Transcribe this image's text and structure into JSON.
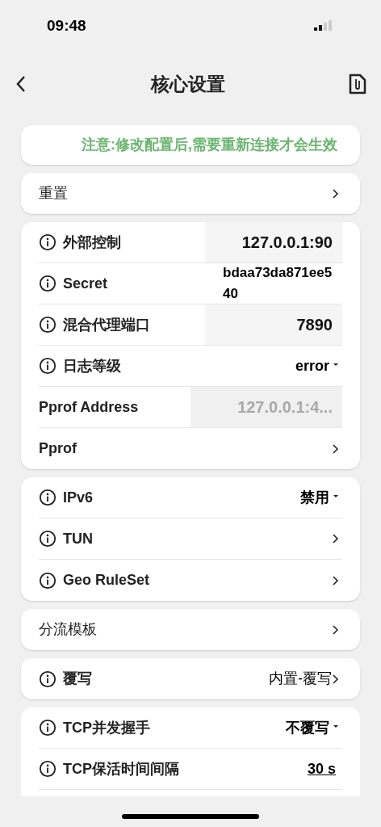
{
  "status_bar": {
    "time": "09:48"
  },
  "header": {
    "title": "核心设置"
  },
  "notice": "注意:修改配置后,需要重新连接才会生效",
  "cards": [
    {
      "rows": [
        {
          "kind": "link",
          "info": false,
          "label": "重置"
        }
      ]
    },
    {
      "rows": [
        {
          "kind": "input",
          "info": true,
          "label": "外部控制",
          "value": "127.0.0.1:90",
          "disabled": false
        },
        {
          "kind": "text",
          "info": true,
          "label": "Secret",
          "value": "bdaa73da871ee540"
        },
        {
          "kind": "input",
          "info": true,
          "label": "混合代理端口",
          "value": "7890",
          "disabled": false
        },
        {
          "kind": "dropdown",
          "info": true,
          "label": "日志等级",
          "value": "error"
        },
        {
          "kind": "input",
          "info": false,
          "label": "Pprof Address",
          "value": "127.0.0.1:4...",
          "disabled": true
        },
        {
          "kind": "link",
          "info": false,
          "label": "Pprof"
        }
      ]
    },
    {
      "rows": [
        {
          "kind": "dropdown",
          "info": true,
          "label": "IPv6",
          "value": "禁用"
        },
        {
          "kind": "link",
          "info": true,
          "label": "TUN"
        },
        {
          "kind": "link",
          "info": true,
          "label": "Geo RuleSet"
        }
      ]
    },
    {
      "rows": [
        {
          "kind": "link",
          "info": false,
          "label": "分流模板"
        }
      ]
    },
    {
      "rows": [
        {
          "kind": "link",
          "info": true,
          "label": "覆写",
          "value": "内置-覆写"
        }
      ]
    },
    {
      "cut": true,
      "rows": [
        {
          "kind": "dropdown",
          "info": true,
          "label": "TCP并发握手",
          "value": "不覆写"
        },
        {
          "kind": "underlined",
          "info": true,
          "label": "TCP保活时间间隔",
          "value": "30 s"
        }
      ]
    }
  ]
}
